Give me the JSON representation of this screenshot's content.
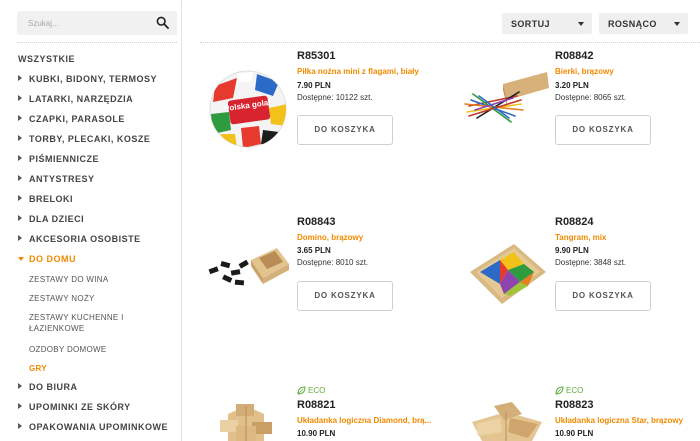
{
  "search": {
    "placeholder": "Szukaj..."
  },
  "sidebar": {
    "categories": [
      {
        "label": "WSZYSTKIE"
      },
      {
        "label": "KUBKI, BIDONY, TERMOSY"
      },
      {
        "label": "LATARKI, NARZĘDZIA"
      },
      {
        "label": "CZAPKI, PARASOLE"
      },
      {
        "label": "TORBY, PLECAKI, KOSZE"
      },
      {
        "label": "PIŚMIENNICZE"
      },
      {
        "label": "ANTYSTRESY"
      },
      {
        "label": "BRELOKI"
      },
      {
        "label": "DLA DZIECI"
      },
      {
        "label": "AKCESORIA OSOBISTE"
      },
      {
        "label": "DO DOMU"
      },
      {
        "label": "DO BIURA"
      },
      {
        "label": "UPOMINKI ZE SKÓRY"
      },
      {
        "label": "OPAKOWANIA UPOMINKOWE"
      }
    ],
    "subcategories": [
      {
        "label": "ZESTAWY DO WINA"
      },
      {
        "label": "ZESTAWY NOŻY"
      },
      {
        "label": "ZESTAWY KUCHENNE I ŁAZIENKOWE"
      },
      {
        "label": "OZDOBY DOMOWE"
      },
      {
        "label": "GRY"
      }
    ]
  },
  "toolbar": {
    "sort_label": "SORTUJ",
    "order_label": "ROSNĄCO"
  },
  "products": [
    {
      "code": "R85301",
      "name": "Piłka nożna mini z flagami, biały",
      "price": "7.90 PLN",
      "stock": "Dostępne:  10122 szt.",
      "button": "DO KOSZYKA",
      "ball_text": "Polska gola!"
    },
    {
      "code": "R08842",
      "name": "Bierki, brązowy",
      "price": "3.20 PLN",
      "stock": "Dostępne:  8065 szt.",
      "button": "DO KOSZYKA"
    },
    {
      "code": "R08843",
      "name": "Domino, brązowy",
      "price": "3.65 PLN",
      "stock": "Dostępne:  8010 szt.",
      "button": "DO KOSZYKA"
    },
    {
      "code": "R08824",
      "name": "Tangram, mix",
      "price": "9.90 PLN",
      "stock": "Dostępne:  3848 szt.",
      "button": "DO KOSZYKA"
    },
    {
      "code": "R08821",
      "name": "Układanka logiczna Diamond, brą...",
      "price": "10.90 PLN",
      "eco": "ECO"
    },
    {
      "code": "R08823",
      "name": "Układanka logiczna Star, brązowy",
      "price": "10.90 PLN",
      "eco": "ECO"
    }
  ],
  "colors": {
    "accent": "#f08a00",
    "eco": "#5fae3b"
  }
}
